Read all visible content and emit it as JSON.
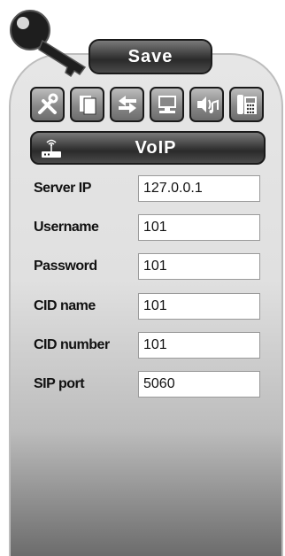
{
  "header": {
    "save_label": "Save"
  },
  "toolbar": {
    "icons": [
      "tools-icon",
      "documents-icon",
      "transfer-arrows-icon",
      "computer-icon",
      "speaker-music-icon",
      "desk-phone-icon"
    ]
  },
  "section": {
    "title": "VoIP",
    "icon": "router-icon"
  },
  "form": {
    "fields": [
      {
        "label": "Server IP",
        "value": "127.0.0.1"
      },
      {
        "label": "Username",
        "value": "101"
      },
      {
        "label": "Password",
        "value": "101"
      },
      {
        "label": "CID name",
        "value": "101"
      },
      {
        "label": "CID number",
        "value": "101"
      },
      {
        "label": "SIP port",
        "value": "5060"
      }
    ]
  }
}
